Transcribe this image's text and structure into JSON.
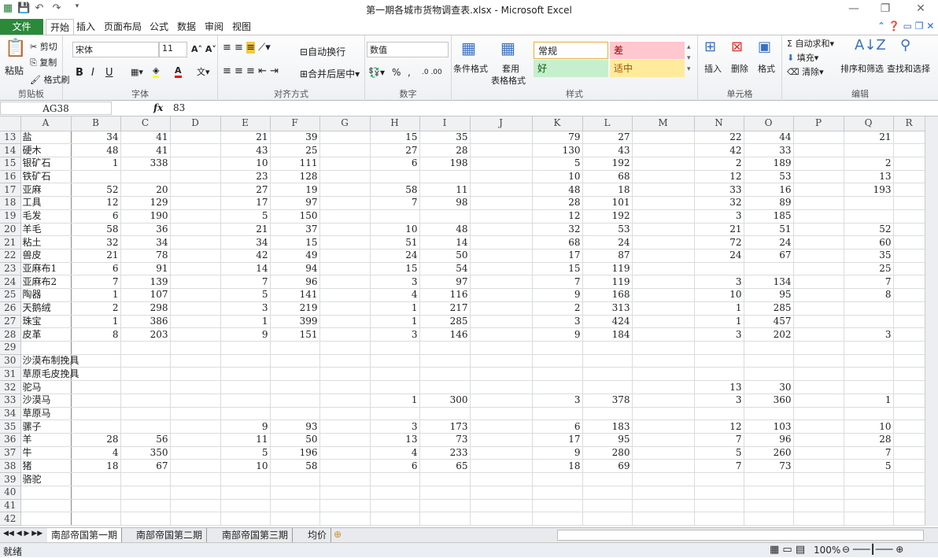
{
  "window": {
    "title": "第一期各城市货物调查表.xlsx - Microsoft Excel"
  },
  "menu": {
    "file": "文件",
    "tabs": [
      "开始",
      "插入",
      "页面布局",
      "公式",
      "数据",
      "审阅",
      "视图"
    ]
  },
  "ribbon": {
    "clipboard": {
      "paste": "粘贴",
      "cut": "剪切",
      "copy": "复制",
      "format_painter": "格式刷",
      "label": "剪贴板"
    },
    "font": {
      "name": "宋体",
      "size": "11",
      "bold": "B",
      "italic": "I",
      "underline": "U",
      "label": "字体"
    },
    "alignment": {
      "wrap": "自动换行",
      "merge": "合并后居中",
      "label": "对齐方式"
    },
    "number": {
      "format": "数值",
      "percent": "%",
      "comma": ",",
      "label": "数字"
    },
    "styles": {
      "conditional": "条件格式",
      "table_format_1": "套用",
      "table_format_2": "表格格式",
      "normal": "常规",
      "bad": "差",
      "good": "好",
      "neutral": "适中",
      "label": "样式"
    },
    "cells": {
      "insert": "插入",
      "delete": "删除",
      "format": "格式",
      "label": "单元格"
    },
    "editing": {
      "autosum": "自动求和",
      "fill": "填充",
      "clear": "清除",
      "sort": "排序和筛选",
      "find": "查找和选择",
      "label": "编辑"
    }
  },
  "formula_bar": {
    "name_box": "AG38",
    "fx": "fx",
    "value": "83"
  },
  "columns": [
    "A",
    "B",
    "C",
    "D",
    "E",
    "F",
    "G",
    "H",
    "I",
    "J",
    "K",
    "L",
    "M",
    "N",
    "O",
    "P",
    "Q",
    "R"
  ],
  "rows": [
    {
      "n": "13",
      "c": [
        "盐",
        "34",
        "41",
        "",
        "21",
        "39",
        "",
        "15",
        "35",
        "",
        "79",
        "27",
        "",
        "22",
        "44",
        "",
        "21"
      ]
    },
    {
      "n": "14",
      "c": [
        "硬木",
        "48",
        "41",
        "",
        "43",
        "25",
        "",
        "27",
        "28",
        "",
        "130",
        "43",
        "",
        "42",
        "33",
        "",
        ""
      ]
    },
    {
      "n": "15",
      "c": [
        "银矿石",
        "1",
        "338",
        "",
        "10",
        "111",
        "",
        "6",
        "198",
        "",
        "5",
        "192",
        "",
        "2",
        "189",
        "",
        "2"
      ]
    },
    {
      "n": "16",
      "c": [
        "铁矿石",
        "",
        "",
        "",
        "23",
        "128",
        "",
        "",
        "",
        "",
        "10",
        "68",
        "",
        "12",
        "53",
        "",
        "13"
      ]
    },
    {
      "n": "17",
      "c": [
        "亚麻",
        "52",
        "20",
        "",
        "27",
        "19",
        "",
        "58",
        "11",
        "",
        "48",
        "18",
        "",
        "33",
        "16",
        "",
        "193"
      ]
    },
    {
      "n": "18",
      "c": [
        "工具",
        "12",
        "129",
        "",
        "17",
        "97",
        "",
        "7",
        "98",
        "",
        "28",
        "101",
        "",
        "32",
        "89",
        "",
        ""
      ]
    },
    {
      "n": "19",
      "c": [
        "毛发",
        "6",
        "190",
        "",
        "5",
        "150",
        "",
        "",
        "",
        "",
        "12",
        "192",
        "",
        "3",
        "185",
        "",
        ""
      ]
    },
    {
      "n": "20",
      "c": [
        "羊毛",
        "58",
        "36",
        "",
        "21",
        "37",
        "",
        "10",
        "48",
        "",
        "32",
        "53",
        "",
        "21",
        "51",
        "",
        "52"
      ]
    },
    {
      "n": "21",
      "c": [
        "粘土",
        "32",
        "34",
        "",
        "34",
        "15",
        "",
        "51",
        "14",
        "",
        "68",
        "24",
        "",
        "72",
        "24",
        "",
        "60"
      ]
    },
    {
      "n": "22",
      "c": [
        "兽皮",
        "21",
        "78",
        "",
        "42",
        "49",
        "",
        "24",
        "50",
        "",
        "17",
        "87",
        "",
        "24",
        "67",
        "",
        "35"
      ]
    },
    {
      "n": "23",
      "c": [
        "亚麻布1",
        "6",
        "91",
        "",
        "14",
        "94",
        "",
        "15",
        "54",
        "",
        "15",
        "119",
        "",
        "",
        "",
        "",
        "25"
      ]
    },
    {
      "n": "24",
      "c": [
        "亚麻布2",
        "7",
        "139",
        "",
        "7",
        "96",
        "",
        "3",
        "97",
        "",
        "7",
        "119",
        "",
        "3",
        "134",
        "",
        "7"
      ]
    },
    {
      "n": "25",
      "c": [
        "陶器",
        "1",
        "107",
        "",
        "5",
        "141",
        "",
        "4",
        "116",
        "",
        "9",
        "168",
        "",
        "10",
        "95",
        "",
        "8"
      ]
    },
    {
      "n": "26",
      "c": [
        "天鹅绒",
        "2",
        "298",
        "",
        "3",
        "219",
        "",
        "1",
        "217",
        "",
        "2",
        "313",
        "",
        "1",
        "285",
        "",
        ""
      ]
    },
    {
      "n": "27",
      "c": [
        "珠宝",
        "1",
        "386",
        "",
        "1",
        "399",
        "",
        "1",
        "285",
        "",
        "3",
        "424",
        "",
        "1",
        "457",
        "",
        ""
      ]
    },
    {
      "n": "28",
      "c": [
        "皮革",
        "8",
        "203",
        "",
        "9",
        "151",
        "",
        "3",
        "146",
        "",
        "9",
        "184",
        "",
        "3",
        "202",
        "",
        "3"
      ]
    },
    {
      "n": "29",
      "c": [
        "",
        "",
        "",
        "",
        "",
        "",
        "",
        "",
        "",
        "",
        "",
        "",
        "",
        "",
        "",
        "",
        ""
      ]
    },
    {
      "n": "30",
      "c": [
        "沙漠布制挽具",
        "",
        "",
        "",
        "",
        "",
        "",
        "",
        "",
        "",
        "",
        "",
        "",
        "",
        "",
        "",
        ""
      ]
    },
    {
      "n": "31",
      "c": [
        "草原毛皮挽具",
        "",
        "",
        "",
        "",
        "",
        "",
        "",
        "",
        "",
        "",
        "",
        "",
        "",
        "",
        "",
        ""
      ]
    },
    {
      "n": "32",
      "c": [
        "驼马",
        "",
        "",
        "",
        "",
        "",
        "",
        "",
        "",
        "",
        "",
        "",
        "",
        "13",
        "30",
        "",
        ""
      ]
    },
    {
      "n": "33",
      "c": [
        "沙漠马",
        "",
        "",
        "",
        "",
        "",
        "",
        "1",
        "300",
        "",
        "3",
        "378",
        "",
        "3",
        "360",
        "",
        "1"
      ]
    },
    {
      "n": "34",
      "c": [
        "草原马",
        "",
        "",
        "",
        "",
        "",
        "",
        "",
        "",
        "",
        "",
        "",
        "",
        "",
        "",
        "",
        ""
      ]
    },
    {
      "n": "35",
      "c": [
        "骡子",
        "",
        "",
        "",
        "9",
        "93",
        "",
        "3",
        "173",
        "",
        "6",
        "183",
        "",
        "12",
        "103",
        "",
        "10"
      ]
    },
    {
      "n": "36",
      "c": [
        "羊",
        "28",
        "56",
        "",
        "11",
        "50",
        "",
        "13",
        "73",
        "",
        "17",
        "95",
        "",
        "7",
        "96",
        "",
        "28"
      ]
    },
    {
      "n": "37",
      "c": [
        "牛",
        "4",
        "350",
        "",
        "5",
        "196",
        "",
        "4",
        "233",
        "",
        "9",
        "280",
        "",
        "5",
        "260",
        "",
        "7"
      ]
    },
    {
      "n": "38",
      "c": [
        "猪",
        "18",
        "67",
        "",
        "10",
        "58",
        "",
        "6",
        "65",
        "",
        "18",
        "69",
        "",
        "7",
        "73",
        "",
        "5"
      ]
    },
    {
      "n": "39",
      "c": [
        "骆驼",
        "",
        "",
        "",
        "",
        "",
        "",
        "",
        "",
        "",
        "",
        "",
        "",
        "",
        "",
        "",
        ""
      ]
    },
    {
      "n": "40",
      "c": [
        "",
        "",
        "",
        "",
        "",
        "",
        "",
        "",
        "",
        "",
        "",
        "",
        "",
        "",
        "",
        "",
        ""
      ]
    },
    {
      "n": "41",
      "c": [
        "",
        "",
        "",
        "",
        "",
        "",
        "",
        "",
        "",
        "",
        "",
        "",
        "",
        "",
        "",
        "",
        ""
      ]
    },
    {
      "n": "42",
      "c": [
        "",
        "",
        "",
        "",
        "",
        "",
        "",
        "",
        "",
        "",
        "",
        "",
        "",
        "",
        "",
        "",
        ""
      ]
    }
  ],
  "sheets": [
    "南部帝国第一期",
    "南部帝国第二期",
    "南部帝国第三期",
    "均价"
  ],
  "status": {
    "ready": "就绪",
    "zoom": "100%"
  }
}
